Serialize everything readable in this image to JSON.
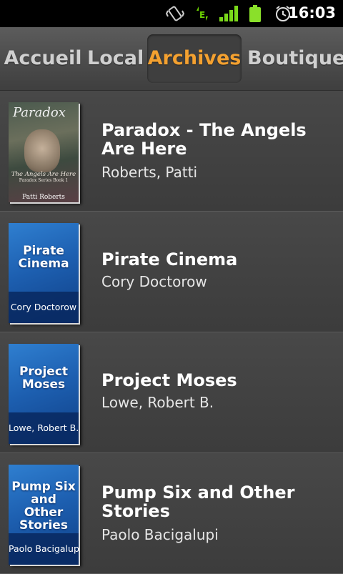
{
  "statusbar": {
    "time": "16:03",
    "icons": [
      "vibrate-icon",
      "edge-data-icon",
      "signal-icon",
      "battery-icon",
      "alarm-icon"
    ],
    "network_label": "E"
  },
  "tabs": [
    {
      "label": "Accueil",
      "active": false
    },
    {
      "label": "Local",
      "active": false
    },
    {
      "label": "Archives",
      "active": true
    },
    {
      "label": "Boutique",
      "active": false
    }
  ],
  "accent_color": "#f4a130",
  "books": [
    {
      "title": "Paradox - The Angels Are Here",
      "author": "Roberts, Patti",
      "cover": {
        "title": "Paradox",
        "subtitle": "The Angels Are Here",
        "series": "Paradox Series Book 1",
        "author": "Patti Roberts"
      }
    },
    {
      "title": "Pirate Cinema",
      "author": "Cory Doctorow",
      "cover": {
        "title": "Pirate Cinema",
        "author": "Cory Doctorow"
      }
    },
    {
      "title": "Project Moses",
      "author": "Lowe, Robert B.",
      "cover": {
        "title": "Project Moses",
        "author": "Lowe, Robert B."
      }
    },
    {
      "title": "Pump Six and Other Stories",
      "author": "Paolo Bacigalupi",
      "cover": {
        "title": "Pump Six and Other Stories",
        "author": "Paolo Bacigalupi"
      }
    }
  ]
}
